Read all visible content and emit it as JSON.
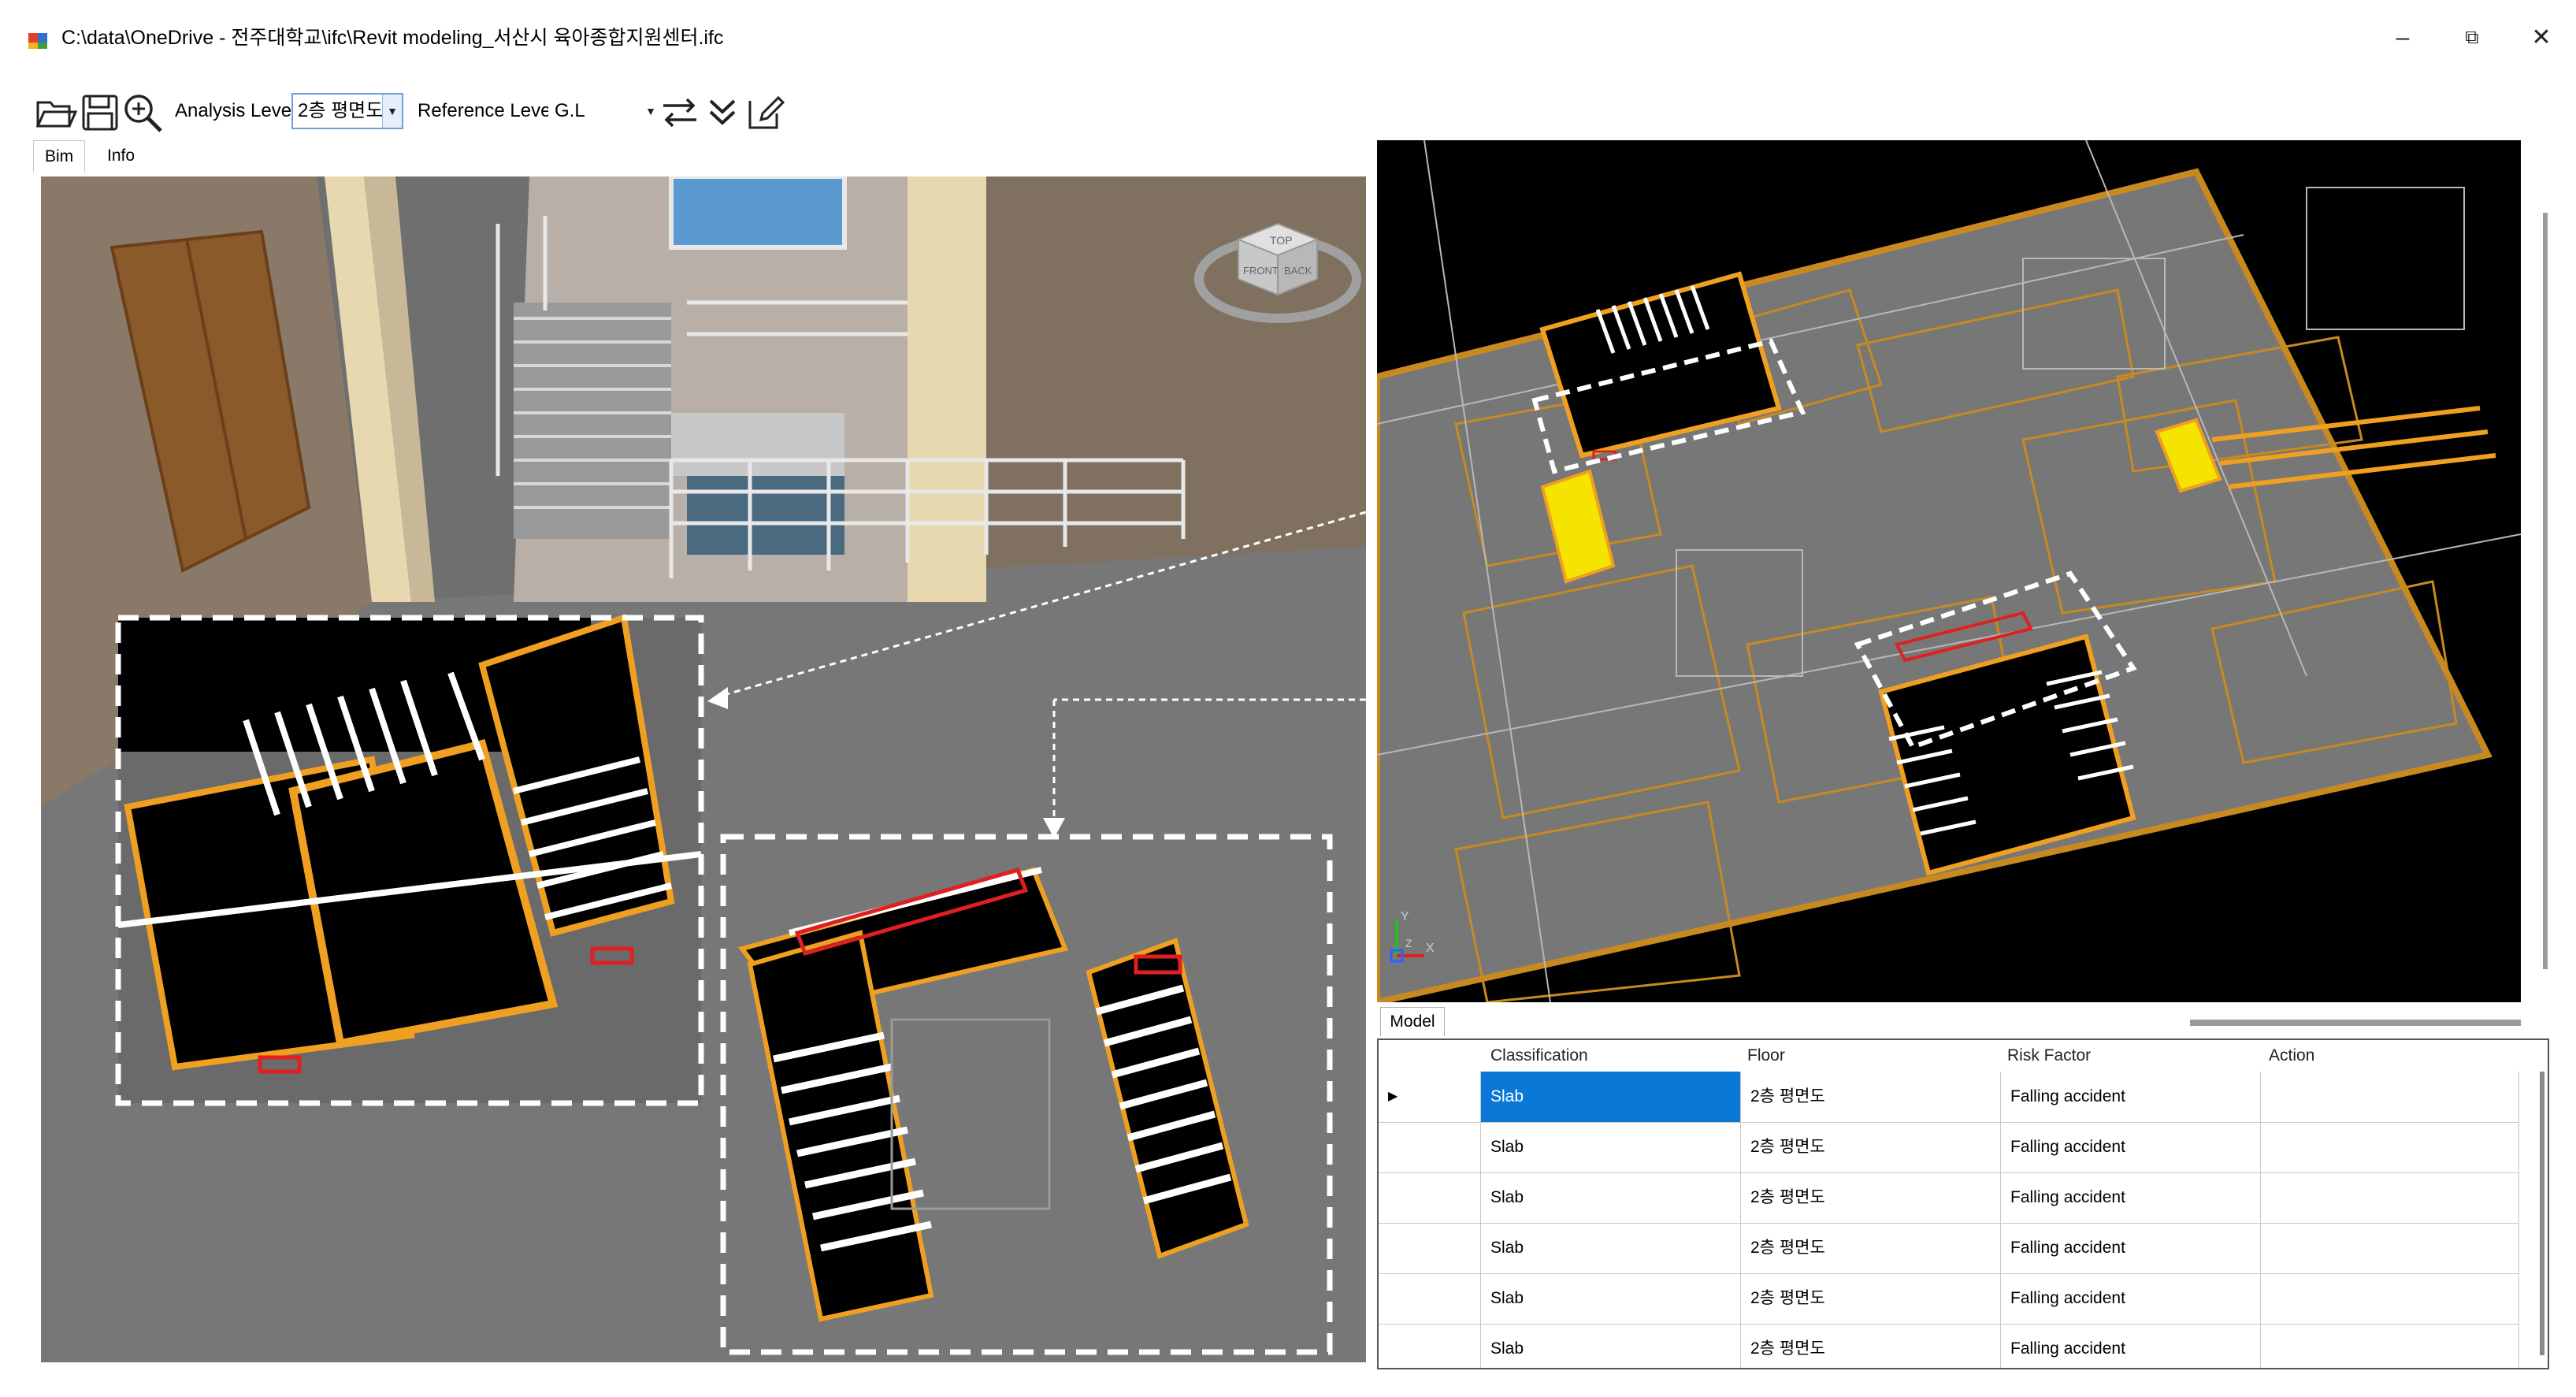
{
  "window": {
    "title": "C:\\data\\OneDrive - 전주대학교\\ifc\\Revit modeling_서산시 육아종합지원센터.ifc",
    "minimize_glyph": "–",
    "restore_glyph": "⧉",
    "close_glyph": "✕"
  },
  "toolbar": {
    "open_icon": "folder-open-icon",
    "save_icon": "save-icon",
    "zoom_icon": "zoom-icon",
    "analysis_label": "Analysis Level",
    "analysis_value": "2층 평면도",
    "reference_label": "Reference Level",
    "reference_value": "G.L",
    "swap_icon": "swap-arrows-icon",
    "expand_icon": "double-chevron-down-icon",
    "edit_icon": "edit-icon"
  },
  "tabs": [
    {
      "label": "Bim",
      "active": true
    },
    {
      "label": "Info",
      "active": false
    }
  ],
  "viewcube": {
    "top": "TOP",
    "front": "FRONT",
    "back": "BACK"
  },
  "axis": {
    "y": "Y",
    "x": "X",
    "z": "Z"
  },
  "model": {
    "tab_label": "Model",
    "columns": [
      "Classification",
      "Floor",
      "Risk Factor",
      "Action"
    ],
    "rows": [
      {
        "classification": "Slab",
        "floor": "2층 평면도",
        "risk": "Falling accident",
        "action": "",
        "selected": true
      },
      {
        "classification": "Slab",
        "floor": "2층 평면도",
        "risk": "Falling accident",
        "action": "",
        "selected": false
      },
      {
        "classification": "Slab",
        "floor": "2층 평면도",
        "risk": "Falling accident",
        "action": "",
        "selected": false
      },
      {
        "classification": "Slab",
        "floor": "2층 평면도",
        "risk": "Falling accident",
        "action": "",
        "selected": false
      },
      {
        "classification": "Slab",
        "floor": "2층 평면도",
        "risk": "Falling accident",
        "action": "",
        "selected": false
      },
      {
        "classification": "Slab",
        "floor": "2층 평면도",
        "risk": "Falling accident",
        "action": "",
        "selected": false
      }
    ]
  },
  "colors": {
    "accent": "#0a78d7",
    "highlight_outline": "#f0a020",
    "risk_outline": "#e02020",
    "selected_slab": "#f5e400"
  }
}
